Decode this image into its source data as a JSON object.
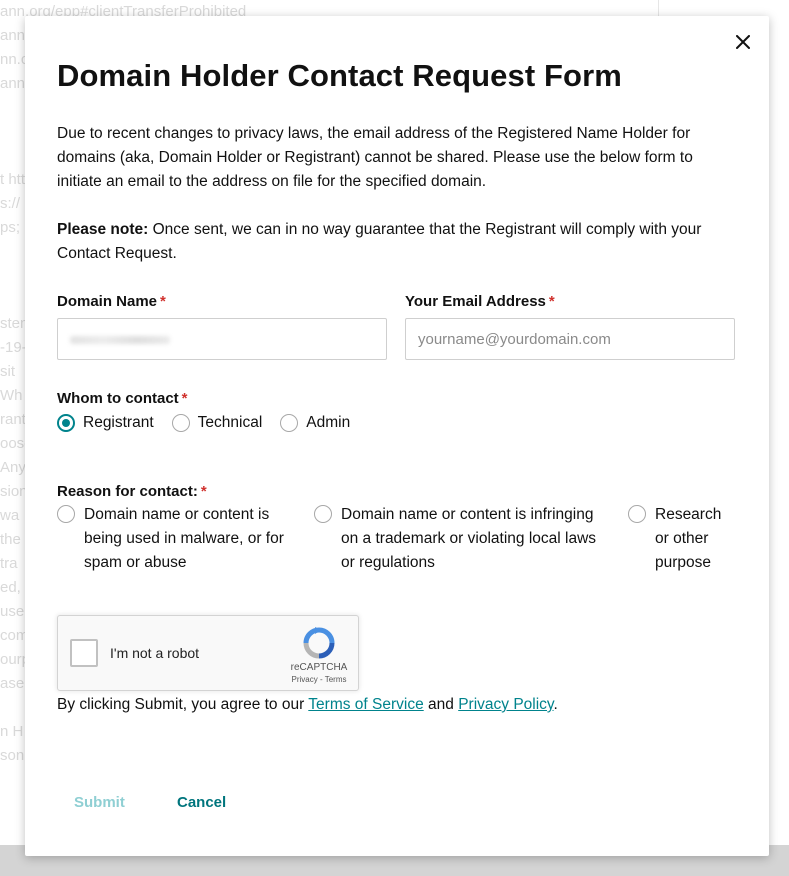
{
  "background": {
    "lines": [
      "ann.org/epp#clientTransferProhibited",
      "ann.",
      "nn.c",
      "ann.o",
      "",
      "",
      "",
      "t htt",
      "s://",
      "ps;",
      "",
      "",
      "",
      "stem",
      "-19-",
      "sit",
      " Wh",
      "rant",
      "oose",
      " Any",
      "sion",
      " wa",
      "the",
      " tra",
      "ed,",
      "use",
      "com",
      "ourp",
      "ase",
      "",
      "n H",
      "son"
    ]
  },
  "modal": {
    "title": "Domain Holder Contact Request Form",
    "intro": "Due to recent changes to privacy laws, the email address of the Registered Name Holder for domains (aka, Domain Holder or Registrant) cannot be shared. Please use the below form to initiate an email to the address on file for the specified domain.",
    "note_label": "Please note:",
    "note_text": " Once sent, we can in no way guarantee that the Registrant will comply with your Contact Request.",
    "required_mark": "*",
    "domain": {
      "label": "Domain Name",
      "value": ""
    },
    "email": {
      "label": "Your Email Address",
      "placeholder": "yourname@yourdomain.com"
    },
    "whom": {
      "label": "Whom to contact",
      "options": [
        "Registrant",
        "Technical",
        "Admin"
      ],
      "selected": "Registrant"
    },
    "reason": {
      "label": "Reason for contact:",
      "options": [
        "Domain name or content is being used in malware, or for spam or abuse",
        "Domain name or content is infringing on a trademark or violating local laws or regulations",
        "Research or other purpose"
      ]
    },
    "captcha": {
      "label": "I'm not a robot",
      "brand": "reCAPTCHA",
      "privacy": "Privacy",
      "separator": " - ",
      "terms": "Terms"
    },
    "agreement": {
      "prefix": "By clicking Submit, you agree to our ",
      "tos": "Terms of Service",
      "middle": " and ",
      "privacy": "Privacy Policy",
      "suffix": "."
    },
    "buttons": {
      "submit": "Submit",
      "cancel": "Cancel"
    },
    "colors": {
      "accent": "#00838c",
      "required": "#d0312d",
      "submit_disabled": "#8fcfd3"
    }
  }
}
